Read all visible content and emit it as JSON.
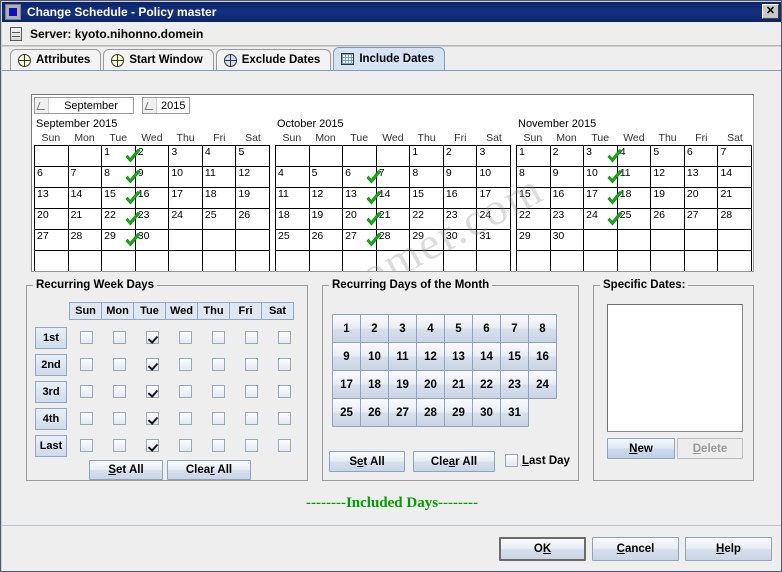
{
  "window": {
    "title": "Change Schedule - Policy master",
    "close_label": "✕",
    "icon": "app-icon"
  },
  "server_bar": {
    "label": "Server: kyoto.nihonno.domein",
    "icon": "server-icon"
  },
  "tabs": [
    {
      "label": "Attributes",
      "icon": "globe-icon",
      "active": false
    },
    {
      "label": "Start Window",
      "icon": "globe-icon",
      "active": false
    },
    {
      "label": "Exclude Dates",
      "icon": "globe-icon",
      "active": false
    },
    {
      "label": "Include Dates",
      "icon": "calendar-icon",
      "active": true
    }
  ],
  "calendar": {
    "month_selector": "September",
    "year_selector": "2015",
    "weekday_headers": [
      "Sun",
      "Mon",
      "Tue",
      "Wed",
      "Thu",
      "Fri",
      "Sat"
    ],
    "watermark": "sertlersomer.com",
    "months": [
      {
        "title": "September 2015",
        "weeks": [
          [
            "",
            "",
            "1",
            "2",
            "3",
            "4",
            "5"
          ],
          [
            "6",
            "7",
            "8",
            "9",
            "10",
            "11",
            "12"
          ],
          [
            "13",
            "14",
            "15",
            "16",
            "17",
            "18",
            "19"
          ],
          [
            "20",
            "21",
            "22",
            "23",
            "24",
            "25",
            "26"
          ],
          [
            "27",
            "28",
            "29",
            "30",
            "",
            "",
            ""
          ],
          [
            "",
            "",
            "",
            "",
            "",
            "",
            ""
          ]
        ],
        "checked_days": [
          "1",
          "8",
          "15",
          "22",
          "29"
        ]
      },
      {
        "title": "October 2015",
        "weeks": [
          [
            "",
            "",
            "",
            "",
            "1",
            "2",
            "3"
          ],
          [
            "4",
            "5",
            "6",
            "7",
            "8",
            "9",
            "10"
          ],
          [
            "11",
            "12",
            "13",
            "14",
            "15",
            "16",
            "17"
          ],
          [
            "18",
            "19",
            "20",
            "21",
            "22",
            "23",
            "24"
          ],
          [
            "25",
            "26",
            "27",
            "28",
            "29",
            "30",
            "31"
          ],
          [
            "",
            "",
            "",
            "",
            "",
            "",
            ""
          ]
        ],
        "checked_days": [
          "6",
          "13",
          "20",
          "27"
        ]
      },
      {
        "title": "November 2015",
        "weeks": [
          [
            "1",
            "2",
            "3",
            "4",
            "5",
            "6",
            "7"
          ],
          [
            "8",
            "9",
            "10",
            "11",
            "12",
            "13",
            "14"
          ],
          [
            "15",
            "16",
            "17",
            "18",
            "19",
            "20",
            "21"
          ],
          [
            "22",
            "23",
            "24",
            "25",
            "26",
            "27",
            "28"
          ],
          [
            "29",
            "30",
            "",
            "",
            "",
            "",
            ""
          ],
          [
            "",
            "",
            "",
            "",
            "",
            "",
            ""
          ]
        ],
        "checked_days": [
          "3",
          "10",
          "17",
          "24"
        ]
      }
    ]
  },
  "recurring_week_days": {
    "title": "Recurring Week Days",
    "columns": [
      "Sun",
      "Mon",
      "Tue",
      "Wed",
      "Thu",
      "Fri",
      "Sat"
    ],
    "rows": [
      "1st",
      "2nd",
      "3rd",
      "4th",
      "Last"
    ],
    "checked": [
      [
        false,
        false,
        true,
        false,
        false,
        false,
        false
      ],
      [
        false,
        false,
        true,
        false,
        false,
        false,
        false
      ],
      [
        false,
        false,
        true,
        false,
        false,
        false,
        false
      ],
      [
        false,
        false,
        true,
        false,
        false,
        false,
        false
      ],
      [
        false,
        false,
        true,
        false,
        false,
        false,
        false
      ]
    ],
    "set_all_label": "Set All",
    "clear_all_label": "Clear All"
  },
  "recurring_days_of_month": {
    "title": "Recurring Days of the Month",
    "days": [
      [
        "1",
        "2",
        "3",
        "4",
        "5",
        "6",
        "7",
        "8"
      ],
      [
        "9",
        "10",
        "11",
        "12",
        "13",
        "14",
        "15",
        "16"
      ],
      [
        "17",
        "18",
        "19",
        "20",
        "21",
        "22",
        "23",
        "24"
      ],
      [
        "25",
        "26",
        "27",
        "28",
        "29",
        "30",
        "31"
      ]
    ],
    "set_all_label": "Set All",
    "clear_all_label": "Clear All",
    "last_day_label": "Last Day",
    "last_day_checked": false
  },
  "specific_dates": {
    "title": "Specific Dates:",
    "items": [],
    "new_label": "New",
    "delete_label": "Delete",
    "delete_enabled": false
  },
  "included_caption": "--------Included Days--------",
  "footer": {
    "ok_label": "OK",
    "cancel_label": "Cancel",
    "help_label": "Help"
  },
  "colors": {
    "titlebar": "#0a246a",
    "panel": "#eeeeee",
    "accent_tab": "#d6e3f5",
    "check_green": "#00a000",
    "included_text": "#00a000"
  }
}
